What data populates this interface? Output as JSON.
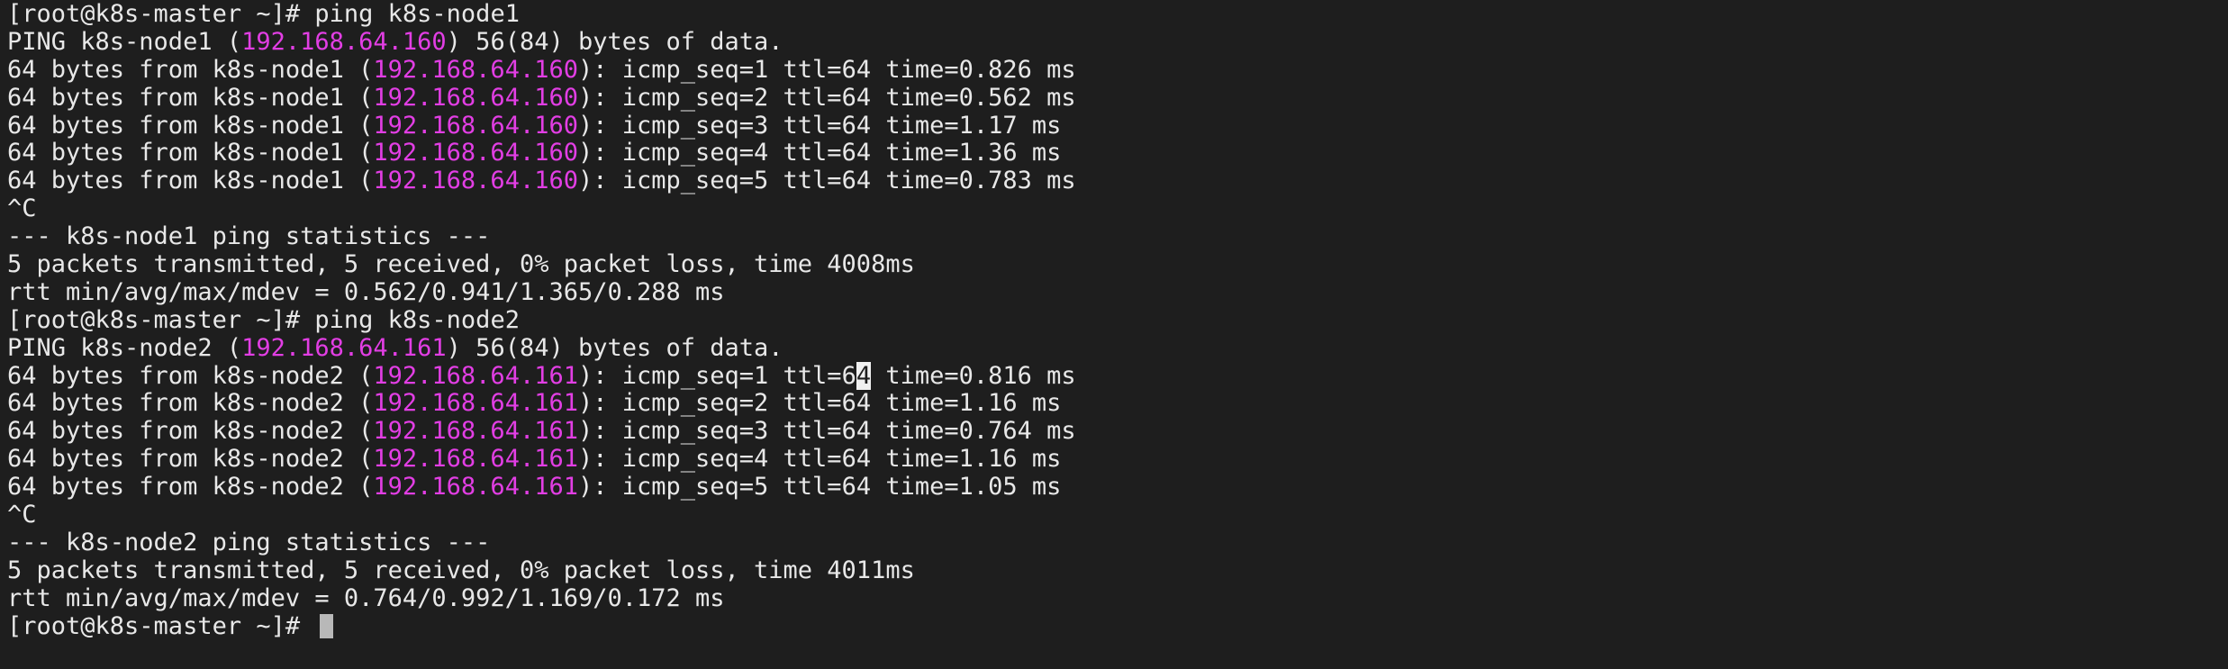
{
  "terminal": {
    "prompt": "[root@k8s-master ~]# ",
    "colors": {
      "background": "#1e1e1e",
      "foreground": "#e8e8e8",
      "ip_highlight": "#e23ee4",
      "cursor": "#b8b8b8"
    },
    "block1": {
      "command": "ping k8s-node1",
      "header": {
        "pre": "PING k8s-node1 (",
        "ip": "192.168.64.160",
        "post": ") 56(84) bytes of data."
      },
      "replies": [
        {
          "pre": "64 bytes from k8s-node1 (",
          "ip": "192.168.64.160",
          "post": "): icmp_seq=1 ttl=64 time=0.826 ms"
        },
        {
          "pre": "64 bytes from k8s-node1 (",
          "ip": "192.168.64.160",
          "post": "): icmp_seq=2 ttl=64 time=0.562 ms"
        },
        {
          "pre": "64 bytes from k8s-node1 (",
          "ip": "192.168.64.160",
          "post": "): icmp_seq=3 ttl=64 time=1.17 ms"
        },
        {
          "pre": "64 bytes from k8s-node1 (",
          "ip": "192.168.64.160",
          "post": "): icmp_seq=4 ttl=64 time=1.36 ms"
        },
        {
          "pre": "64 bytes from k8s-node1 (",
          "ip": "192.168.64.160",
          "post": "): icmp_seq=5 ttl=64 time=0.783 ms"
        }
      ],
      "interrupt": "^C",
      "stats_title": "--- k8s-node1 ping statistics ---",
      "stats_packets": "5 packets transmitted, 5 received, 0% packet loss, time 4008ms",
      "stats_rtt": "rtt min/avg/max/mdev = 0.562/0.941/1.365/0.288 ms"
    },
    "block2": {
      "command": "ping k8s-node2",
      "header": {
        "pre": "PING k8s-node2 (",
        "ip": "192.168.64.161",
        "post": ") 56(84) bytes of data."
      },
      "replies": [
        {
          "pre": "64 bytes from k8s-node2 (",
          "ip": "192.168.64.161",
          "post_a": "): icmp_seq=1 ttl=6",
          "post_hl": "4",
          "post_b": " time=0.816 ms"
        },
        {
          "pre": "64 bytes from k8s-node2 (",
          "ip": "192.168.64.161",
          "post": "): icmp_seq=2 ttl=64 time=1.16 ms"
        },
        {
          "pre": "64 bytes from k8s-node2 (",
          "ip": "192.168.64.161",
          "post": "): icmp_seq=3 ttl=64 time=0.764 ms"
        },
        {
          "pre": "64 bytes from k8s-node2 (",
          "ip": "192.168.64.161",
          "post": "): icmp_seq=4 ttl=64 time=1.16 ms"
        },
        {
          "pre": "64 bytes from k8s-node2 (",
          "ip": "192.168.64.161",
          "post": "): icmp_seq=5 ttl=64 time=1.05 ms"
        }
      ],
      "interrupt": "^C",
      "stats_title": "--- k8s-node2 ping statistics ---",
      "stats_packets": "5 packets transmitted, 5 received, 0% packet loss, time 4011ms",
      "stats_rtt": "rtt min/avg/max/mdev = 0.764/0.992/1.169/0.172 ms"
    }
  }
}
